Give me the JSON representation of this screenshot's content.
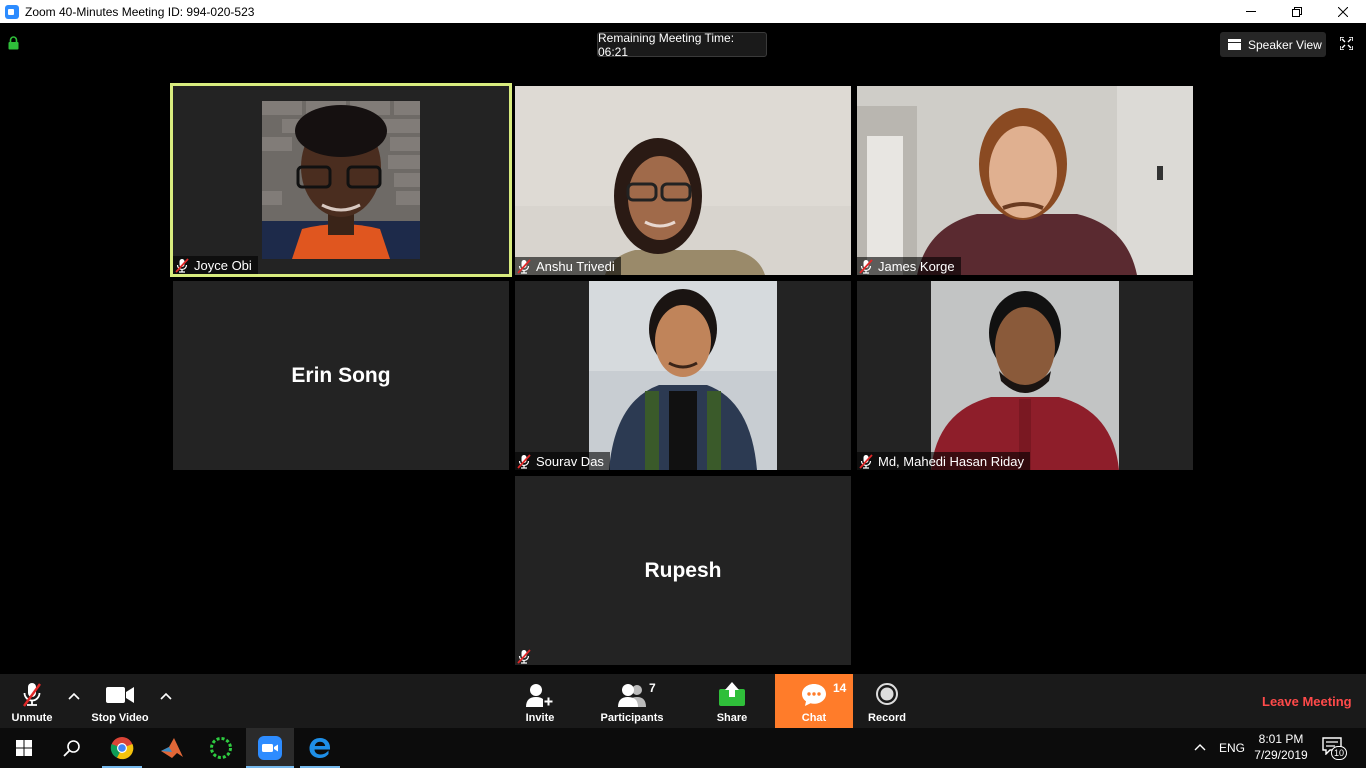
{
  "window": {
    "title": "Zoom 40-Minutes Meeting ID: 994-020-523",
    "minimize": "—",
    "restore": "❐",
    "close": "✕"
  },
  "meeting": {
    "remaining_time": "Remaining Meeting Time: 06:21",
    "view_button": "Speaker View",
    "participants": [
      {
        "name": "Joyce Obi",
        "muted": true,
        "video": true,
        "active_speaker": true
      },
      {
        "name": "Anshu Trivedi",
        "muted": true,
        "video": true
      },
      {
        "name": "James Korge",
        "muted": true,
        "video": true
      },
      {
        "name": "Erin Song",
        "muted": false,
        "video": false
      },
      {
        "name": "Sourav Das",
        "muted": true,
        "video": true
      },
      {
        "name": "Md, Mahedi Hasan Riday",
        "muted": true,
        "video": true
      },
      {
        "name": "Rupesh",
        "muted": true,
        "video": false
      }
    ]
  },
  "toolbar": {
    "unmute": "Unmute",
    "stop_video": "Stop Video",
    "invite": "Invite",
    "participants": "Participants",
    "participants_count": "7",
    "share": "Share",
    "chat": "Chat",
    "chat_count": "14",
    "record": "Record",
    "leave": "Leave Meeting"
  },
  "taskbar": {
    "language": "ENG",
    "time": "8:01 PM",
    "date": "7/29/2019",
    "notification_count": "10"
  },
  "colors": {
    "active_speaker_border": "#d8ec7e",
    "chat_accent": "#ff7c2a",
    "leave_red": "#ff4a4a",
    "share_green": "#2fbf3a"
  }
}
